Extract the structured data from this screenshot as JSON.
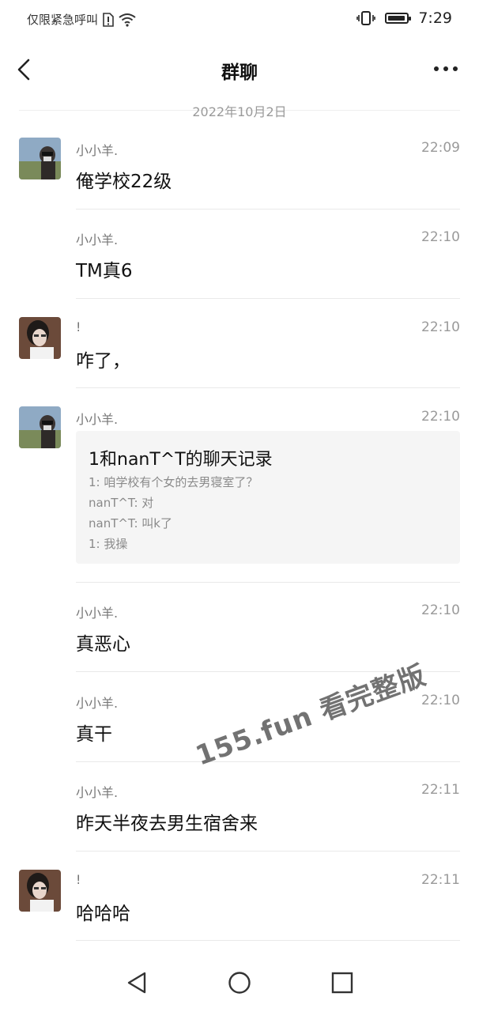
{
  "status_bar": {
    "carrier_text": "仅限紧急呼叫",
    "time": "7:29",
    "battery_level": 0.95
  },
  "nav": {
    "title": "群聊",
    "back_icon": "chevron-left-icon",
    "more_icon": "more-horizontal-icon"
  },
  "date_separator": "2022年10月2日",
  "messages": [
    {
      "sender": "小小羊.",
      "time": "22:09",
      "text": "俺学校22级",
      "avatar": "avatar-sheep"
    },
    {
      "sender": "小小羊.",
      "time": "22:10",
      "text": "TM真6"
    },
    {
      "sender": "!",
      "time": "22:10",
      "text": "咋了，",
      "avatar": "avatar-exclaim"
    },
    {
      "sender": "小小羊.",
      "time": "22:10",
      "avatar": "avatar-sheep",
      "record": {
        "title": "1和nanT^T的聊天记录",
        "lines": [
          "1: 咱学校有个女的去男寝室了？",
          "nanT^T: 对",
          "nanT^T: 叫k了",
          "1: 我操"
        ]
      }
    },
    {
      "sender": "小小羊.",
      "time": "22:10",
      "text": "真恶心"
    },
    {
      "sender": "小小羊.",
      "time": "22:10",
      "text": "真干"
    },
    {
      "sender": "小小羊.",
      "time": "22:11",
      "text": "昨天半夜去男生宿舍来"
    },
    {
      "sender": "!",
      "time": "22:11",
      "text": "哈哈哈",
      "avatar": "avatar-exclaim"
    }
  ],
  "watermark": "155.fun 看完整版",
  "system_nav": {
    "back_icon": "triangle-back-icon",
    "home_icon": "circle-home-icon",
    "recents_icon": "square-recents-icon"
  }
}
